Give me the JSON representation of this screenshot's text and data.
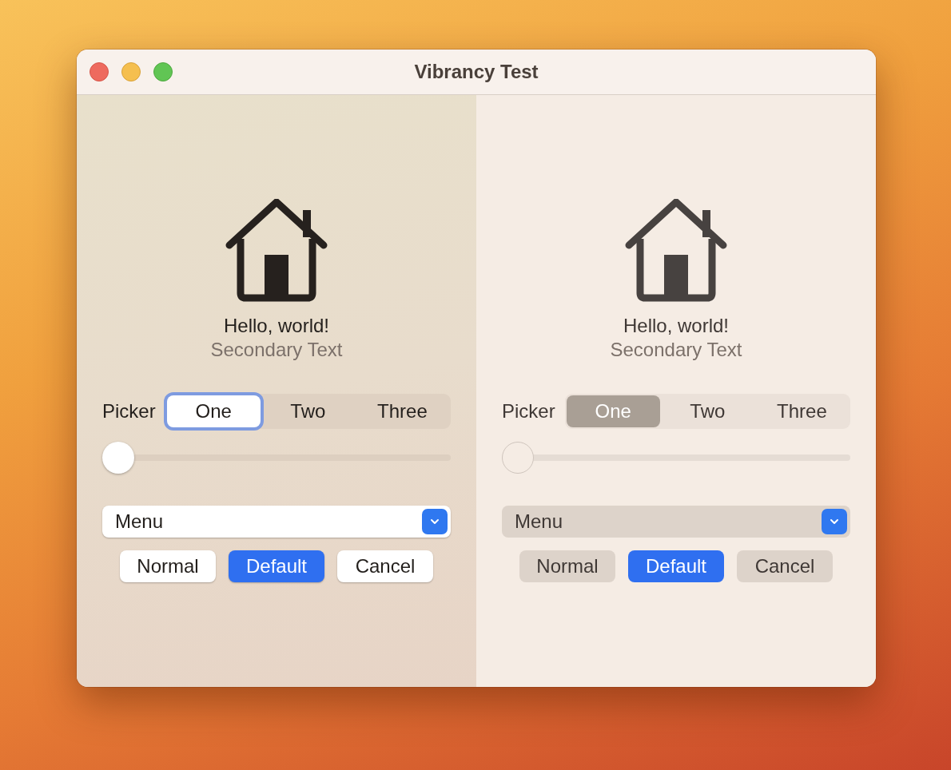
{
  "window": {
    "title": "Vibrancy Test"
  },
  "panes": [
    {
      "kind": "vibrant",
      "heading": "Hello, world!",
      "secondary": "Secondary Text",
      "picker": {
        "label": "Picker",
        "focused": true,
        "segments": [
          {
            "label": "One",
            "selected": true
          },
          {
            "label": "Two",
            "selected": false
          },
          {
            "label": "Three",
            "selected": false
          }
        ]
      },
      "slider": {
        "level": 0
      },
      "menu": {
        "label": "Menu"
      },
      "buttons": [
        {
          "label": "Normal",
          "kind": "normal"
        },
        {
          "label": "Default",
          "kind": "default"
        },
        {
          "label": "Cancel",
          "kind": "normal"
        }
      ]
    },
    {
      "kind": "plain",
      "heading": "Hello, world!",
      "secondary": "Secondary Text",
      "picker": {
        "label": "Picker",
        "focused": false,
        "segments": [
          {
            "label": "One",
            "selected": true
          },
          {
            "label": "Two",
            "selected": false
          },
          {
            "label": "Three",
            "selected": false
          }
        ]
      },
      "slider": {
        "level": 0
      },
      "menu": {
        "label": "Menu"
      },
      "buttons": [
        {
          "label": "Normal",
          "kind": "normal"
        },
        {
          "label": "Default",
          "kind": "default"
        },
        {
          "label": "Cancel",
          "kind": "normal"
        }
      ]
    }
  ]
}
